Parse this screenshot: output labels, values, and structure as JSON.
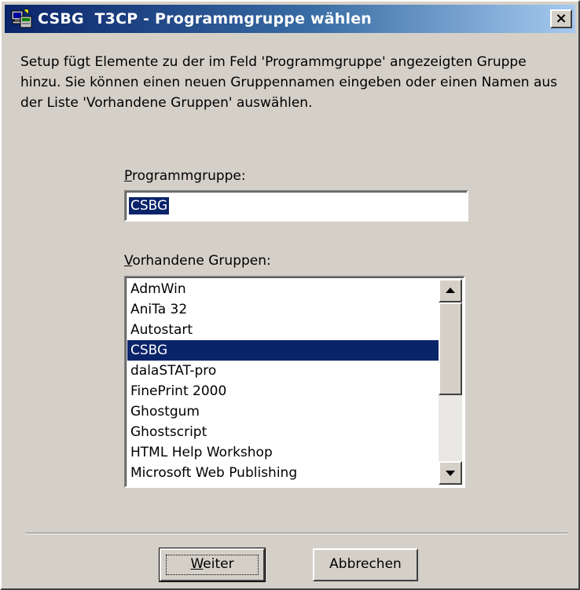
{
  "window": {
    "title": "CSBG  T3CP - Programmgruppe wählen",
    "close_label": "×",
    "icon": "setup-computer-icon"
  },
  "intro": {
    "text": "Setup fügt Elemente zu der im Feld 'Programmgruppe' angezeigten Gruppe hinzu. Sie können einen neuen Gruppennamen eingeben oder einen Namen aus der Liste 'Vorhandene Gruppen' auswählen."
  },
  "program_group": {
    "label_mnemonic": "P",
    "label_rest": "rogrammgruppe:",
    "value": "CSBG"
  },
  "existing_groups": {
    "label_mnemonic": "V",
    "label_rest": "orhandene Gruppen:",
    "items": [
      "AdmWin",
      "AniTa 32",
      "Autostart",
      "CSBG",
      "dalaSTAT-pro",
      "FinePrint 2000",
      "Ghostgum",
      "Ghostscript",
      "HTML Help Workshop",
      "Microsoft Web Publishing"
    ],
    "selected": "CSBG"
  },
  "buttons": {
    "next_mnemonic": "W",
    "next_rest": "eiter",
    "cancel": "Abbrechen"
  },
  "colors": {
    "face": "#d4d0c8",
    "selection": "#0a246a",
    "title_gradient_start": "#0a246a",
    "title_gradient_end": "#a6caf0"
  }
}
